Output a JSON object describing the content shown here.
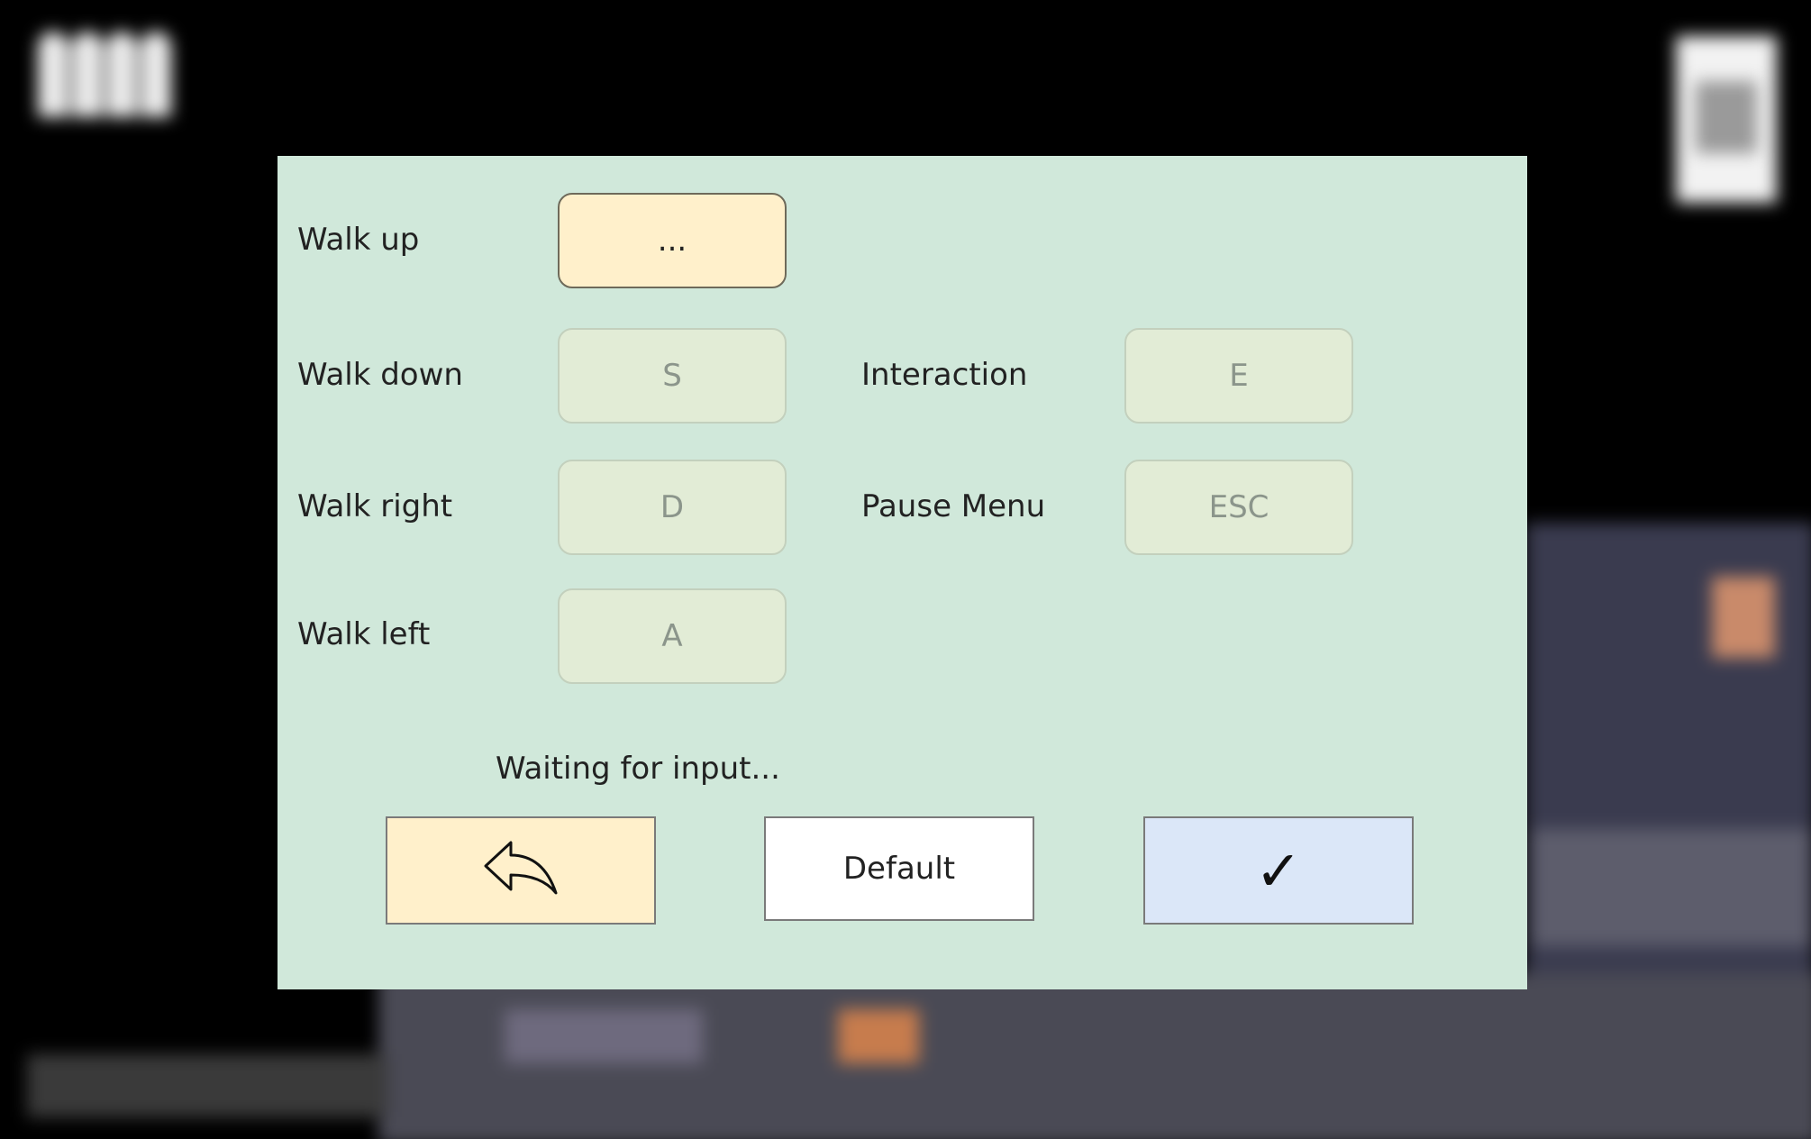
{
  "dialog": {
    "bindings": [
      {
        "action": "Walk up",
        "key": "..."
      },
      {
        "action": "Walk down",
        "key": "S"
      },
      {
        "action": "Walk right",
        "key": "D"
      },
      {
        "action": "Walk left",
        "key": "A"
      },
      {
        "action": "Interaction",
        "key": "E"
      },
      {
        "action": "Pause Menu",
        "key": "ESC"
      }
    ],
    "status": "Waiting for input...",
    "buttons": {
      "back_icon": "back-arrow-icon",
      "default_label": "Default",
      "confirm_label": "✓"
    }
  },
  "colors": {
    "dialog_bg": "#d0e8da",
    "active_key_bg": "#fff0cb",
    "inactive_key_bg": "#e2ecd6",
    "confirm_bg": "#dbe7f8"
  }
}
